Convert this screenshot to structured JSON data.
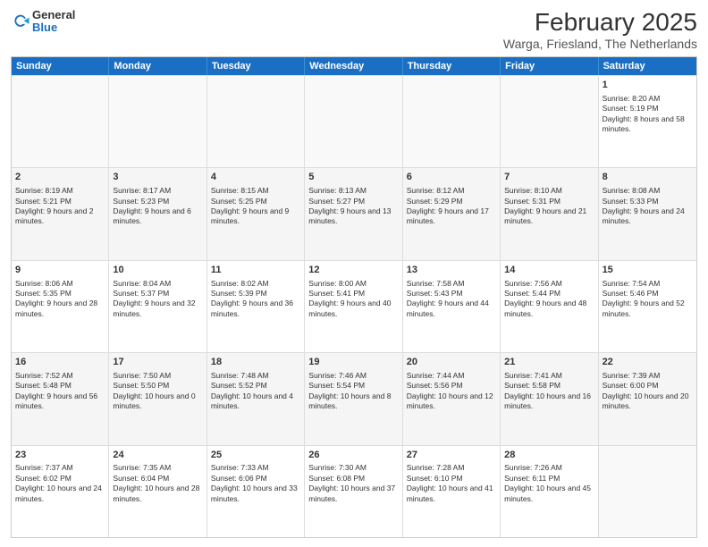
{
  "logo": {
    "general": "General",
    "blue": "Blue"
  },
  "title": "February 2025",
  "subtitle": "Warga, Friesland, The Netherlands",
  "weekdays": [
    "Sunday",
    "Monday",
    "Tuesday",
    "Wednesday",
    "Thursday",
    "Friday",
    "Saturday"
  ],
  "weeks": [
    [
      {
        "day": "",
        "sunrise": "",
        "sunset": "",
        "daylight": "",
        "empty": true
      },
      {
        "day": "",
        "sunrise": "",
        "sunset": "",
        "daylight": "",
        "empty": true
      },
      {
        "day": "",
        "sunrise": "",
        "sunset": "",
        "daylight": "",
        "empty": true
      },
      {
        "day": "",
        "sunrise": "",
        "sunset": "",
        "daylight": "",
        "empty": true
      },
      {
        "day": "",
        "sunrise": "",
        "sunset": "",
        "daylight": "",
        "empty": true
      },
      {
        "day": "",
        "sunrise": "",
        "sunset": "",
        "daylight": "",
        "empty": true
      },
      {
        "day": "1",
        "sunrise": "Sunrise: 8:20 AM",
        "sunset": "Sunset: 5:19 PM",
        "daylight": "Daylight: 8 hours and 58 minutes."
      }
    ],
    [
      {
        "day": "2",
        "sunrise": "Sunrise: 8:19 AM",
        "sunset": "Sunset: 5:21 PM",
        "daylight": "Daylight: 9 hours and 2 minutes."
      },
      {
        "day": "3",
        "sunrise": "Sunrise: 8:17 AM",
        "sunset": "Sunset: 5:23 PM",
        "daylight": "Daylight: 9 hours and 6 minutes."
      },
      {
        "day": "4",
        "sunrise": "Sunrise: 8:15 AM",
        "sunset": "Sunset: 5:25 PM",
        "daylight": "Daylight: 9 hours and 9 minutes."
      },
      {
        "day": "5",
        "sunrise": "Sunrise: 8:13 AM",
        "sunset": "Sunset: 5:27 PM",
        "daylight": "Daylight: 9 hours and 13 minutes."
      },
      {
        "day": "6",
        "sunrise": "Sunrise: 8:12 AM",
        "sunset": "Sunset: 5:29 PM",
        "daylight": "Daylight: 9 hours and 17 minutes."
      },
      {
        "day": "7",
        "sunrise": "Sunrise: 8:10 AM",
        "sunset": "Sunset: 5:31 PM",
        "daylight": "Daylight: 9 hours and 21 minutes."
      },
      {
        "day": "8",
        "sunrise": "Sunrise: 8:08 AM",
        "sunset": "Sunset: 5:33 PM",
        "daylight": "Daylight: 9 hours and 24 minutes."
      }
    ],
    [
      {
        "day": "9",
        "sunrise": "Sunrise: 8:06 AM",
        "sunset": "Sunset: 5:35 PM",
        "daylight": "Daylight: 9 hours and 28 minutes."
      },
      {
        "day": "10",
        "sunrise": "Sunrise: 8:04 AM",
        "sunset": "Sunset: 5:37 PM",
        "daylight": "Daylight: 9 hours and 32 minutes."
      },
      {
        "day": "11",
        "sunrise": "Sunrise: 8:02 AM",
        "sunset": "Sunset: 5:39 PM",
        "daylight": "Daylight: 9 hours and 36 minutes."
      },
      {
        "day": "12",
        "sunrise": "Sunrise: 8:00 AM",
        "sunset": "Sunset: 5:41 PM",
        "daylight": "Daylight: 9 hours and 40 minutes."
      },
      {
        "day": "13",
        "sunrise": "Sunrise: 7:58 AM",
        "sunset": "Sunset: 5:43 PM",
        "daylight": "Daylight: 9 hours and 44 minutes."
      },
      {
        "day": "14",
        "sunrise": "Sunrise: 7:56 AM",
        "sunset": "Sunset: 5:44 PM",
        "daylight": "Daylight: 9 hours and 48 minutes."
      },
      {
        "day": "15",
        "sunrise": "Sunrise: 7:54 AM",
        "sunset": "Sunset: 5:46 PM",
        "daylight": "Daylight: 9 hours and 52 minutes."
      }
    ],
    [
      {
        "day": "16",
        "sunrise": "Sunrise: 7:52 AM",
        "sunset": "Sunset: 5:48 PM",
        "daylight": "Daylight: 9 hours and 56 minutes."
      },
      {
        "day": "17",
        "sunrise": "Sunrise: 7:50 AM",
        "sunset": "Sunset: 5:50 PM",
        "daylight": "Daylight: 10 hours and 0 minutes."
      },
      {
        "day": "18",
        "sunrise": "Sunrise: 7:48 AM",
        "sunset": "Sunset: 5:52 PM",
        "daylight": "Daylight: 10 hours and 4 minutes."
      },
      {
        "day": "19",
        "sunrise": "Sunrise: 7:46 AM",
        "sunset": "Sunset: 5:54 PM",
        "daylight": "Daylight: 10 hours and 8 minutes."
      },
      {
        "day": "20",
        "sunrise": "Sunrise: 7:44 AM",
        "sunset": "Sunset: 5:56 PM",
        "daylight": "Daylight: 10 hours and 12 minutes."
      },
      {
        "day": "21",
        "sunrise": "Sunrise: 7:41 AM",
        "sunset": "Sunset: 5:58 PM",
        "daylight": "Daylight: 10 hours and 16 minutes."
      },
      {
        "day": "22",
        "sunrise": "Sunrise: 7:39 AM",
        "sunset": "Sunset: 6:00 PM",
        "daylight": "Daylight: 10 hours and 20 minutes."
      }
    ],
    [
      {
        "day": "23",
        "sunrise": "Sunrise: 7:37 AM",
        "sunset": "Sunset: 6:02 PM",
        "daylight": "Daylight: 10 hours and 24 minutes."
      },
      {
        "day": "24",
        "sunrise": "Sunrise: 7:35 AM",
        "sunset": "Sunset: 6:04 PM",
        "daylight": "Daylight: 10 hours and 28 minutes."
      },
      {
        "day": "25",
        "sunrise": "Sunrise: 7:33 AM",
        "sunset": "Sunset: 6:06 PM",
        "daylight": "Daylight: 10 hours and 33 minutes."
      },
      {
        "day": "26",
        "sunrise": "Sunrise: 7:30 AM",
        "sunset": "Sunset: 6:08 PM",
        "daylight": "Daylight: 10 hours and 37 minutes."
      },
      {
        "day": "27",
        "sunrise": "Sunrise: 7:28 AM",
        "sunset": "Sunset: 6:10 PM",
        "daylight": "Daylight: 10 hours and 41 minutes."
      },
      {
        "day": "28",
        "sunrise": "Sunrise: 7:26 AM",
        "sunset": "Sunset: 6:11 PM",
        "daylight": "Daylight: 10 hours and 45 minutes."
      },
      {
        "day": "",
        "sunrise": "",
        "sunset": "",
        "daylight": "",
        "empty": true
      }
    ]
  ]
}
